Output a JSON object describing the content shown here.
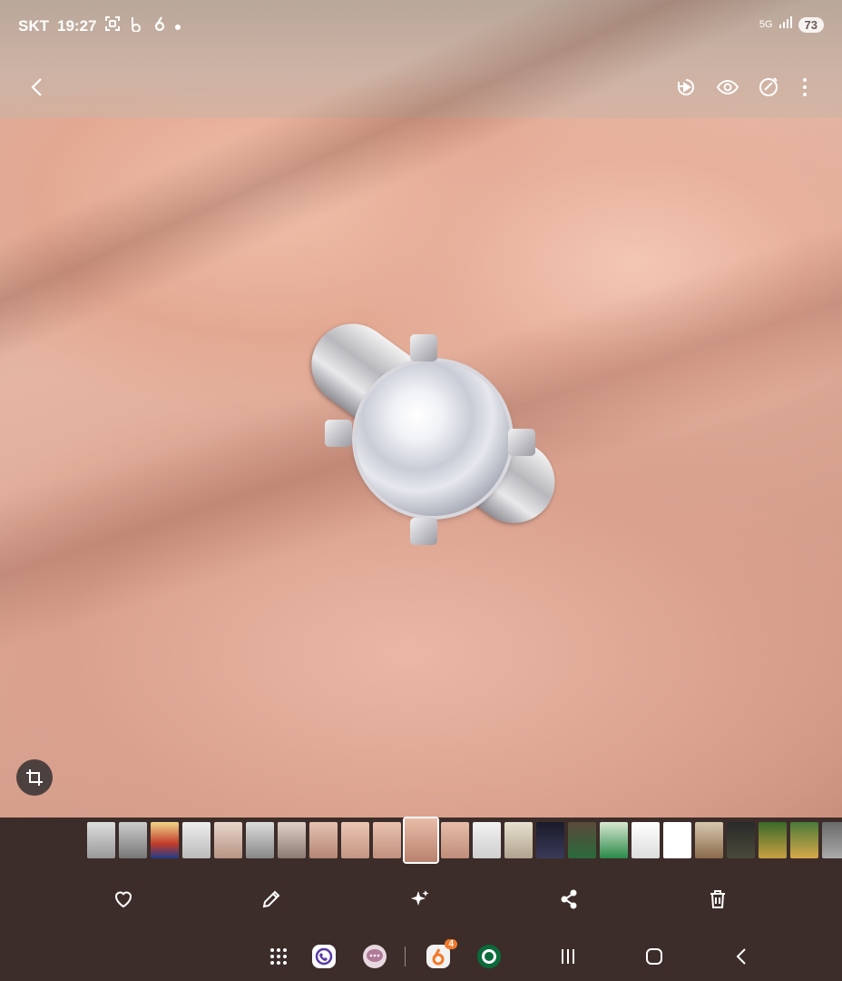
{
  "status_bar": {
    "carrier": "SKT",
    "time": "19:27",
    "network": "5G",
    "battery": "73",
    "icons": [
      "screenshot-icon",
      "b-app-icon",
      "six-app-icon",
      "dot-icon",
      "signal-icon"
    ]
  },
  "app_bar": {
    "actions": [
      "back-icon",
      "motion-photo-icon",
      "view-icon",
      "remaster-icon",
      "more-icon"
    ]
  },
  "bottom_actions": [
    "heart-icon",
    "edit-icon",
    "ai-sparkle-icon",
    "share-icon",
    "delete-icon"
  ],
  "dock": {
    "badge_count": "4",
    "apps": [
      "apps-grid-icon",
      "phone-app",
      "messages-app",
      "six-app",
      "starbucks-app"
    ],
    "nav": [
      "recents-icon",
      "home-icon",
      "back-nav-icon"
    ]
  },
  "colors": {
    "overlay_bg": "#3d2d2a",
    "accent_badge": "#f07a2a"
  }
}
